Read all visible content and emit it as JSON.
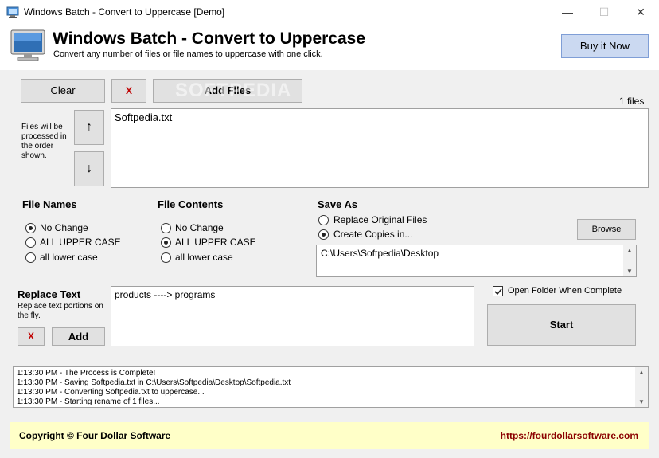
{
  "window": {
    "title": "Windows Batch - Convert to Uppercase [Demo]",
    "minimize_glyph": "—",
    "maximize_glyph": "☐",
    "close_glyph": "✕"
  },
  "header": {
    "title": "Windows Batch - Convert to Uppercase",
    "subtitle": "Convert any number of files or file names to uppercase with one click.",
    "buy_label": "Buy it Now"
  },
  "toolbar": {
    "clear_label": "Clear",
    "remove_label": "X",
    "add_files_label": "Add Files",
    "file_count": "1 files"
  },
  "file_order": {
    "note": "Files will be processed in the order shown.",
    "up_glyph": "↑",
    "down_glyph": "↓"
  },
  "files": [
    "Softpedia.txt"
  ],
  "file_names": {
    "heading": "File Names",
    "options": [
      "No Change",
      "ALL UPPER CASE",
      "all lower case"
    ],
    "selected": 0
  },
  "file_contents": {
    "heading": "File Contents",
    "options": [
      "No Change",
      "ALL UPPER CASE",
      "all lower case"
    ],
    "selected": 1
  },
  "save_as": {
    "heading": "Save As",
    "options": [
      "Replace Original Files",
      "Create Copies in..."
    ],
    "selected": 1,
    "browse_label": "Browse",
    "path": "C:\\Users\\Softpedia\\Desktop"
  },
  "replace_text": {
    "heading": "Replace Text",
    "description": "Replace text portions on the fly.",
    "remove_label": "X",
    "add_label": "Add",
    "rules": [
      "products ----> programs"
    ]
  },
  "options": {
    "open_folder_label": "Open Folder When Complete",
    "open_folder_checked": true,
    "start_label": "Start"
  },
  "log": [
    "1:13:30 PM - The Process is Complete!",
    "1:13:30 PM - Saving Softpedia.txt in C:\\Users\\Softpedia\\Desktop\\Softpedia.txt",
    "1:13:30 PM - Converting Softpedia.txt to uppercase...",
    "1:13:30 PM - Starting rename of 1 files..."
  ],
  "footer": {
    "copyright": "Copyright © Four Dollar Software",
    "link": "https://fourdollarsoftware.com"
  },
  "watermark": "SOFTPEDIA",
  "colors": {
    "buy_button": "#cbd9f1",
    "footer_bg": "#ffffc8",
    "remove_red": "#c00000",
    "link": "#8b0000"
  }
}
